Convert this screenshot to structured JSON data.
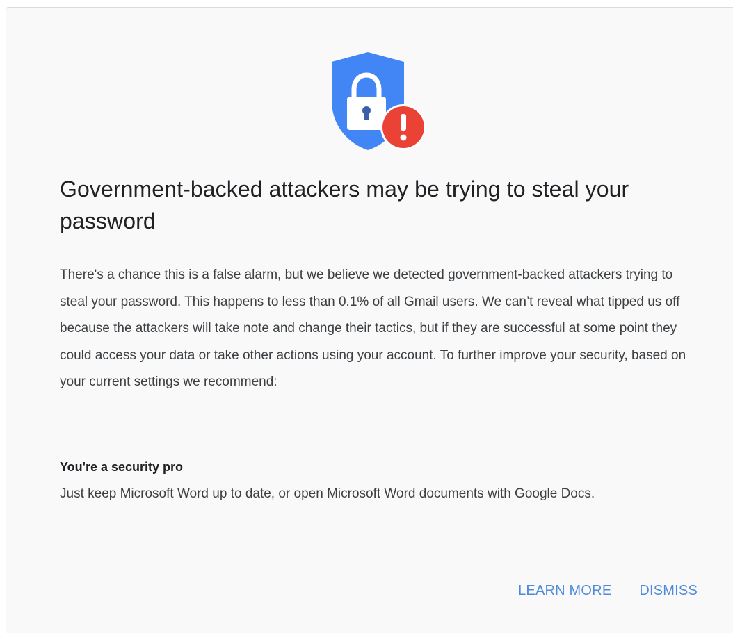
{
  "dialog": {
    "icon": "shield-lock-alert-icon",
    "title": "Government-backed attackers may be trying to steal your password",
    "body": "There's a chance this is a false alarm, but we believe we detected government-backed attackers trying to steal your password. This happens to less than 0.1% of all Gmail users. We can’t reveal what tipped us off because the attackers will take note and change their tactics, but if they are successful at some point they could access your data or take other actions using your account. To further improve your security, based on your current settings we recommend:",
    "recommendation": {
      "title": "You're a security pro",
      "text": "Just keep Microsoft Word up to date, or open Microsoft Word documents with Google Docs."
    },
    "actions": {
      "learn_more": "LEARN MORE",
      "dismiss": "DISMISS"
    }
  },
  "colors": {
    "shield": "#4285f4",
    "alert": "#ea4335",
    "link": "#4f8ad9",
    "background": "#f9f9fa"
  }
}
